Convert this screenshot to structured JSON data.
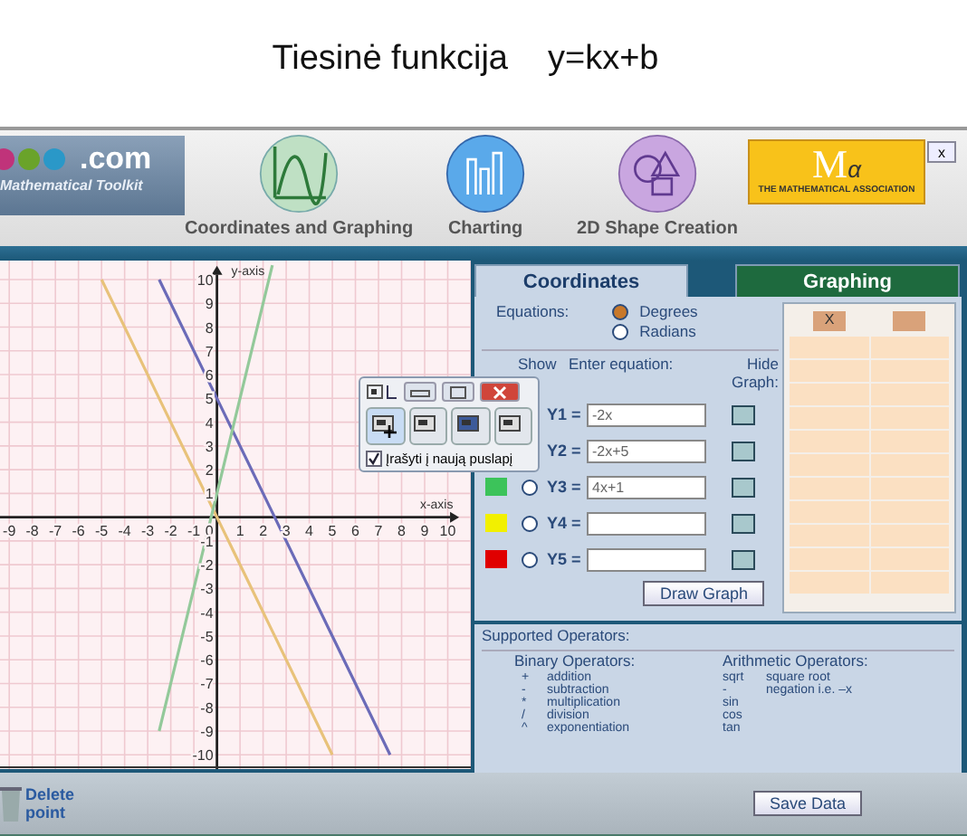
{
  "page_title": {
    "heading": "Tiesinė funkcija",
    "formula": "y=kx+b"
  },
  "header": {
    "logo_text": ".com",
    "logo_subtitle": "Mathematical Toolkit",
    "close": "x",
    "nav": [
      {
        "label": "Coordinates and Graphing",
        "kind": "graph"
      },
      {
        "label": "Charting",
        "kind": "bars"
      },
      {
        "label": "2D Shape Creation",
        "kind": "shapes"
      }
    ],
    "association": {
      "mark": "M",
      "alpha": "α",
      "name": "THE MATHEMATICAL ASSOCIATION"
    }
  },
  "graph": {
    "chart_data": {
      "type": "line",
      "grid": true,
      "xlabel": "x-axis",
      "ylabel": "y-axis",
      "x": [
        -5,
        -2.5,
        0,
        2.4,
        5,
        7.5
      ],
      "xlim": [
        -9.4,
        11
      ],
      "ylim": [
        -10.6,
        10.8
      ],
      "xticks": [
        -9,
        -8,
        -7,
        -6,
        -5,
        -4,
        -3,
        -2,
        -1,
        0,
        1,
        2,
        3,
        4,
        5,
        6,
        7,
        8,
        9,
        10
      ],
      "yticks": [
        -10,
        -9,
        -8,
        -7,
        -6,
        -5,
        -4,
        -3,
        -2,
        -1,
        1,
        2,
        3,
        4,
        5,
        6,
        7,
        8,
        9,
        10
      ],
      "series": [
        {
          "color": "#e8c27a",
          "values": [
            10,
            5,
            0,
            -4.8,
            -10,
            null
          ]
        },
        {
          "color": "#6b6bb8",
          "values": [
            null,
            10,
            5,
            0.2,
            -5,
            -10
          ]
        },
        {
          "color": "#93c99a",
          "values": [
            null,
            -9,
            1,
            10.6,
            null,
            null
          ]
        }
      ]
    }
  },
  "popup": {
    "checkbox_label": "Įrašyti į naują puslapį",
    "checked": true
  },
  "tabs": [
    {
      "label": "Coordinates",
      "selected": true
    },
    {
      "label": "Graphing",
      "selected": false
    }
  ],
  "equations_label": "Equations:",
  "angle_modes": [
    {
      "label": "Degrees",
      "selected": true
    },
    {
      "label": "Radians",
      "selected": false
    }
  ],
  "columns": {
    "show": "Show",
    "enter": "Enter equation:",
    "hide": "Hide Graph:"
  },
  "equations": [
    {
      "label": "Y1 =",
      "value": "-2x",
      "hidden": false
    },
    {
      "label": "Y2 =",
      "value": "-2x+5",
      "hidden": false
    },
    {
      "label": "Y3 =",
      "value": "4x+1",
      "hidden": false,
      "color": "#3cc35a",
      "shown": false
    },
    {
      "label": "Y4 =",
      "hidden": false,
      "color": "#f2f000",
      "shown": false
    },
    {
      "label": "Y5 =",
      "hidden": false,
      "color": "#e00000",
      "shown": false
    }
  ],
  "draw_button": "Draw Graph",
  "table": {
    "columns": [
      "X"
    ]
  },
  "operators": {
    "title": "Supported Operators:",
    "binary_title": "Binary Operators:",
    "binary": [
      {
        "symbol": "+",
        "name": "addition"
      },
      {
        "symbol": "-",
        "name": "subtraction"
      },
      {
        "symbol": "*",
        "name": "multiplication"
      },
      {
        "symbol": "/",
        "name": "division"
      },
      {
        "symbol": "^",
        "name": "exponentiation"
      }
    ],
    "arithmetic_title": "Arithmetic Operators:",
    "arithmetic": [
      {
        "symbol": "sqrt",
        "name": "square root"
      },
      {
        "symbol": "-",
        "name": "negation i.e. –x"
      },
      {
        "symbol": "sin"
      },
      {
        "symbol": "cos"
      },
      {
        "symbol": "tan"
      }
    ]
  },
  "delete_button": "Delete point",
  "save_button": "Save Data"
}
